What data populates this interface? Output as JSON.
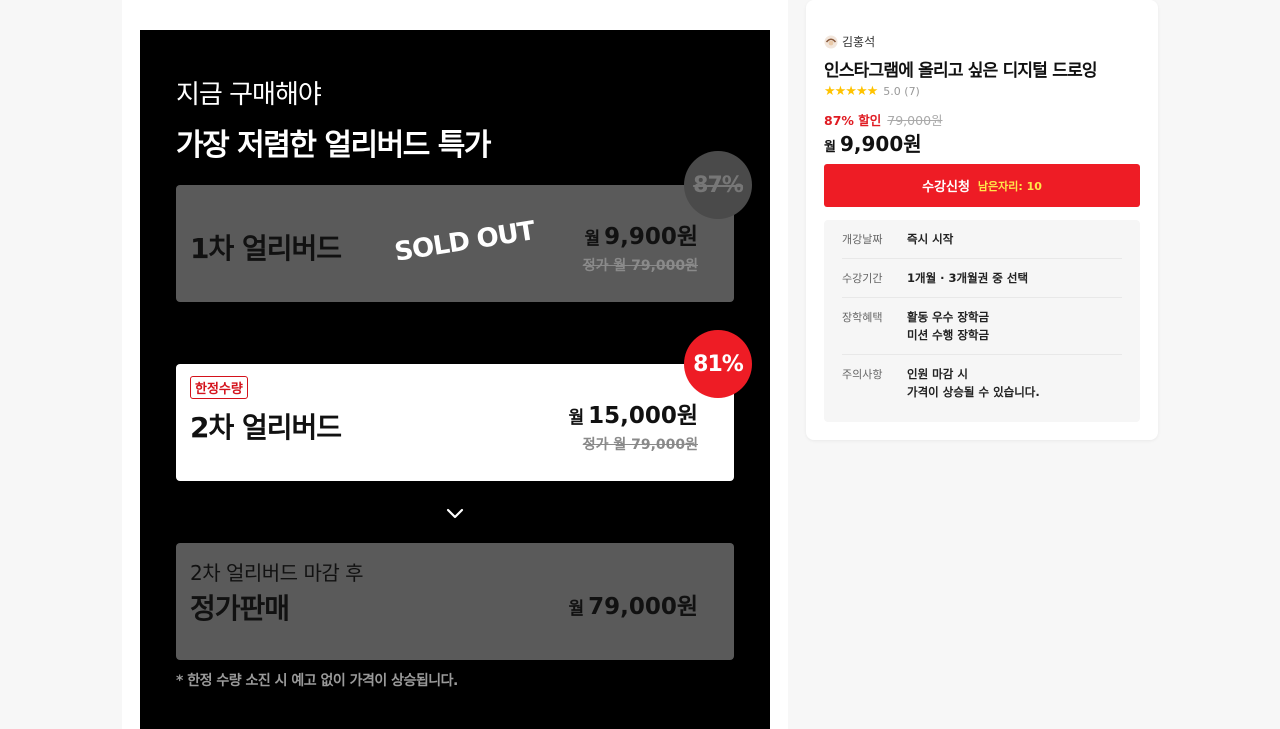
{
  "promo": {
    "subtitle": "지금 구매해야",
    "title": "가장 저렴한 얼리버드 특가",
    "tiers": [
      {
        "name": "1차 얼리버드",
        "status": "SOLD OUT",
        "price_unit": "월",
        "price": "9,900원",
        "regular": "정가 월 79,000원",
        "discount_badge": "87%"
      },
      {
        "tag": "한정수량",
        "name": "2차 얼리버드",
        "price_unit": "월",
        "price": "15,000원",
        "regular": "정가 월 79,000원",
        "discount_badge": "81%"
      }
    ],
    "after": {
      "label": "2차 얼리버드 마감 후",
      "name": "정가판매",
      "price_unit": "월",
      "price": "79,000원"
    },
    "note": "* 한정 수량 소진 시 예고 없이 가격이 상승됩니다."
  },
  "card": {
    "instructor": "김홍석",
    "title": "인스타그램에 올리고 싶은 디지털 드로잉",
    "stars": "★★★★★",
    "rating": "5.0 (7)",
    "discount": "87% 할인",
    "original_price": "79,000원",
    "price_unit": "월",
    "price": "9,900원",
    "enroll_label": "수강신청",
    "seats_left": "남은자리: 10",
    "info": [
      {
        "key": "개강날짜",
        "lines": [
          "즉시 시작"
        ]
      },
      {
        "key": "수강기간",
        "lines": [
          "1개월 · 3개월권 중 선택"
        ]
      },
      {
        "key": "장학혜택",
        "lines": [
          "활동 우수 장학금",
          "미션 수행 장학금"
        ]
      },
      {
        "key": "주의사항",
        "lines": [
          "인원 마감 시",
          "가격이 상승될 수 있습니다."
        ]
      }
    ]
  },
  "colors": {
    "accent_red": "#ee1c25",
    "seats_yellow": "#ffe74a",
    "star_yellow": "#ffc300"
  },
  "icons": {
    "instructor": "avatar-icon",
    "scroll": "chevron-down-icon"
  }
}
